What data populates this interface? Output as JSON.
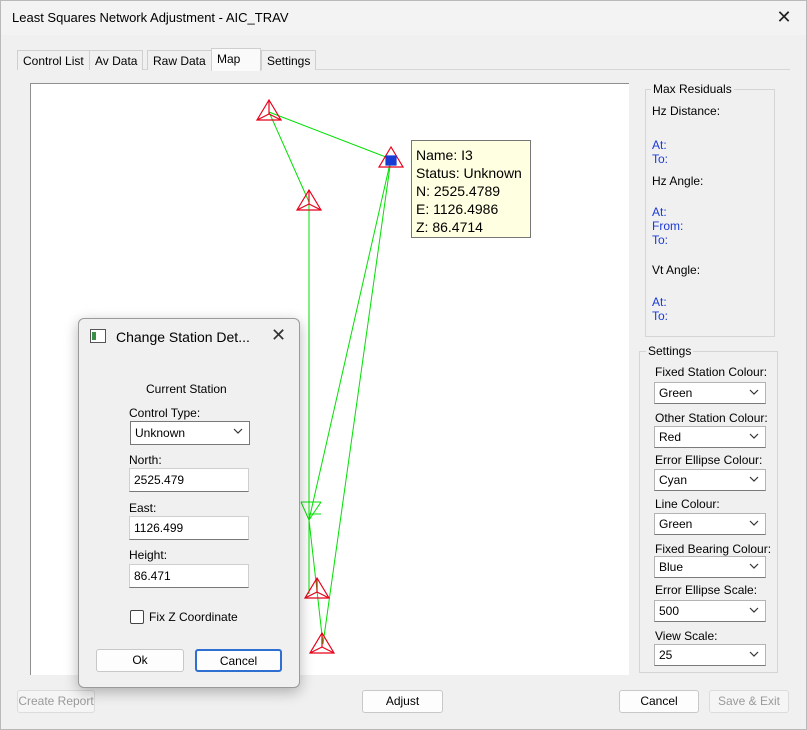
{
  "window": {
    "title": "Least Squares Network Adjustment - AIC_TRAV"
  },
  "tabs": [
    {
      "label": "Control List"
    },
    {
      "label": "Av Data"
    },
    {
      "label": "Raw Data"
    },
    {
      "label": "Map"
    },
    {
      "label": "Settings"
    }
  ],
  "active_tab": "Map",
  "tooltip": {
    "name": "Name: I3",
    "status": "Status: Unknown",
    "north": "N: 2525.4789",
    "east": "E: 1126.4986",
    "z": "Z: 86.4714"
  },
  "max_residuals": {
    "title": "Max Residuals",
    "hz_distance": "Hz Distance:",
    "hz_distance_at": "At:",
    "hz_distance_to": "To:",
    "hz_angle": "Hz Angle:",
    "hz_angle_at": "At:",
    "hz_angle_from": "From:",
    "hz_angle_to": "To:",
    "vt_angle": "Vt Angle:",
    "vt_angle_at": "At:",
    "vt_angle_to": "To:"
  },
  "settings": {
    "title": "Settings",
    "fixed_station_colour_label": "Fixed Station Colour:",
    "fixed_station_colour": "Green",
    "other_station_colour_label": "Other Station Colour:",
    "other_station_colour": "Red",
    "error_ellipse_colour_label": "Error Ellipse Colour:",
    "error_ellipse_colour": "Cyan",
    "line_colour_label": "Line Colour:",
    "line_colour": "Green",
    "fixed_bearing_colour_label": "Fixed Bearing Colour:",
    "fixed_bearing_colour": "Blue",
    "error_ellipse_scale_label": "Error Ellipse Scale:",
    "error_ellipse_scale": "500",
    "view_scale_label": "View Scale:",
    "view_scale": "25"
  },
  "buttons": {
    "create_report": "Create Report",
    "adjust": "Adjust",
    "cancel": "Cancel",
    "save_exit": "Save & Exit"
  },
  "dialog": {
    "title": "Change Station Det...",
    "current_station": "Current Station",
    "control_type_label": "Control Type:",
    "control_type": "Unknown",
    "north_label": "North:",
    "north": "2525.479",
    "east_label": "East:",
    "east": "1126.499",
    "height_label": "Height:",
    "height": "86.471",
    "fix_z": "Fix Z Coordinate",
    "fix_z_checked": false,
    "ok": "Ok",
    "cancel": "Cancel"
  },
  "colors": {
    "station": "#e8001a",
    "line": "#00e000",
    "selected_station": "#1a3ad6",
    "tooltip_bg": "#ffffe1",
    "residual_text": "#1a3ad6"
  }
}
